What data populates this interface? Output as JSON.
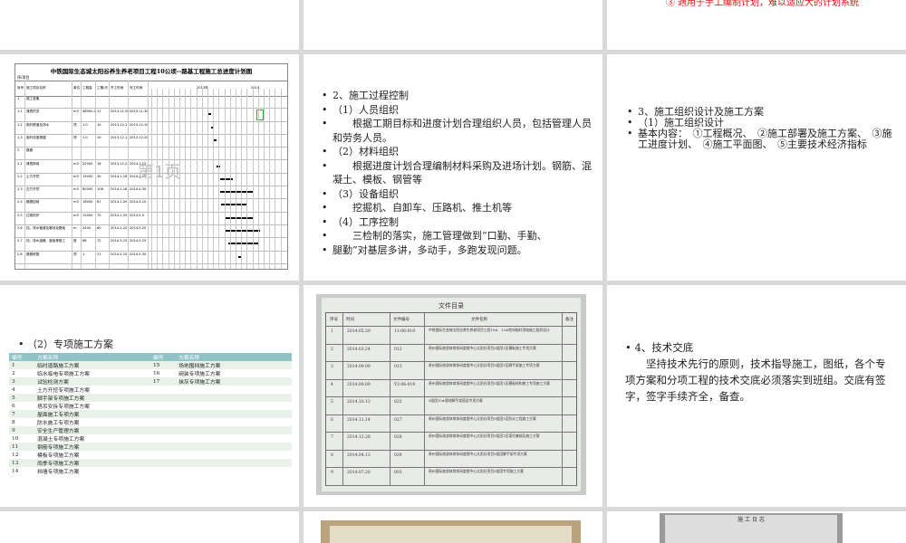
{
  "slide_top_right": {
    "text": "③ 適用于手工编制计划，难以适应大的计划系统"
  },
  "gantt": {
    "title": "中铁国际生态城太阳谷养生养老项目工程10公顷--路基工程施工总进度计划图",
    "subtitle": "序/项目",
    "headers": [
      "序号",
      "施工项目名称",
      "单位",
      "工程量",
      "工期/天",
      "开工时间",
      "完工时间",
      "2013年",
      "2014"
    ],
    "rows": [
      {
        "no": "1",
        "name": "施工准备",
        "unit": "",
        "qty": "",
        "days": "",
        "start": "",
        "end": ""
      },
      {
        "no": "1.1",
        "name": "清表挖淤",
        "unit": "m3",
        "qty": "46000.0",
        "days": "11",
        "start": "2013.11.20",
        "end": "2013.11.30"
      },
      {
        "no": "1.2",
        "name": "临时便道及排水",
        "unit": "项",
        "qty": "1.0",
        "days": "10",
        "start": "2013.12.1",
        "end": "2013.12.10"
      },
      {
        "no": "1.3",
        "name": "临时设施搭建",
        "unit": "项",
        "qty": "1.0",
        "days": "10",
        "start": "2013.12.11",
        "end": "2013.12.20"
      },
      {
        "no": "2",
        "name": "路基",
        "unit": "",
        "qty": "",
        "days": "",
        "start": "",
        "end": ""
      },
      {
        "no": "2.1",
        "name": "清表换填",
        "unit": "m3",
        "qty": "22000",
        "days": "16",
        "start": "2013.12.21",
        "end": "2014.1.15"
      },
      {
        "no": "2.2",
        "name": "土方开挖",
        "unit": "m3",
        "qty": "15000",
        "days": "30",
        "start": "2014.1.16",
        "end": "2014.2.15"
      },
      {
        "no": "2.3",
        "name": "石方开挖",
        "unit": "m3",
        "qty": "80000",
        "days": "108",
        "start": "2014.1.18",
        "end": "2014.4.30"
      },
      {
        "no": "2.4",
        "name": "路基回填",
        "unit": "m3",
        "qty": "18000",
        "days": "81",
        "start": "2014.1.20",
        "end": "2014.4.10"
      },
      {
        "no": "2.5",
        "name": "边坡防护",
        "unit": "m3",
        "qty": "15000",
        "days": "70",
        "start": "2014.2.20",
        "end": "2014.5.0"
      },
      {
        "no": "2.6",
        "name": "挡、排水管道及管线及基础",
        "unit": "m",
        "qty": "2440",
        "days": "60",
        "start": "2014.2.20",
        "end": "2014.5.20"
      },
      {
        "no": "2.7",
        "name": "挡、排水涵管、盖板等施工",
        "unit": "座",
        "qty": "68",
        "days": "72",
        "start": "2014.3.15",
        "end": "2014.5.25"
      },
      {
        "no": "2.8",
        "name": "路基修整",
        "unit": "项",
        "qty": "1",
        "days": "21",
        "start": "2014.5.10",
        "end": "2014.5.30"
      }
    ],
    "watermark": "第1页"
  },
  "process_control": {
    "items": [
      "2、施工过程控制",
      "（1）人员组织",
      "　　根据工期目标和进度计划合理组织人员，包括管理人员和劳务人员。",
      "（2）材料组织",
      "　　根据进度计划合理编制材料采购及进场计划。钢筋、混凝土、模板、钢管等",
      "（3）设备组织",
      "　　挖掘机、自卸车、压路机、推土机等",
      "（4）工序控制",
      "　　三检制的落实，施工管理做到“口勤、手勤、",
      "腿勤”对基层多讲，多动手，多跑发现问题。"
    ]
  },
  "org_design": {
    "items": [
      "3、施工组织设计及施工方案",
      "（1）施工组织设计",
      "基本内容：　①工程概况、　②施工部署及施工方案、　③施工进度计划、　④施工平面图、　⑤主要技术经济指标"
    ]
  },
  "special_plans": {
    "label": "（2）专项施工方案",
    "headers": [
      "编号",
      "方案名称",
      "编号",
      "方案名称"
    ],
    "rows": [
      [
        "1",
        "临时道路施工方案",
        "15",
        "场地围挡施工方案"
      ],
      [
        "2",
        "临水临电专项施工方案",
        "16",
        "碗装专项施工方案"
      ],
      [
        "3",
        "试验检测方案",
        "17",
        "抹灰专项施工方案"
      ],
      [
        "4",
        "土方开挖专项施工方案",
        "",
        ""
      ],
      [
        "5",
        "脚手架专项施工方案",
        "",
        ""
      ],
      [
        "6",
        "塔吊安拆专项施工方案",
        "",
        ""
      ],
      [
        "7",
        "屋面施工专项方案",
        "",
        ""
      ],
      [
        "8",
        "防水施工专项方案",
        "",
        ""
      ],
      [
        "9",
        "安全生产管理方案",
        "",
        ""
      ],
      [
        "10",
        "混凝土专项施工方案",
        "",
        ""
      ],
      [
        "11",
        "钢筋专项施工方案",
        "",
        ""
      ],
      [
        "12",
        "模板专项施工方案",
        "",
        ""
      ],
      [
        "13",
        "雨季专项施工方案",
        "",
        ""
      ],
      [
        "14",
        "挡墙专项施工方案",
        "",
        ""
      ]
    ]
  },
  "file_directory": {
    "title": "文件目录",
    "headers": [
      "序号",
      "时间",
      "文件编号",
      "文件名称",
      "备注"
    ],
    "rows": [
      [
        "1",
        "2014.05.29",
        "11-06-019",
        "中铁国际生态城太阳谷养生养老项目工程10#、12#地块临时用电施工组织设计"
      ],
      [
        "2",
        "2014.03.24",
        "012",
        "贵州国际旅游体育休闲度假中心太阳谷项目5组团1区模板施工专项方案"
      ],
      [
        "3",
        "2014.09.09",
        "013",
        "贵州国际旅游体育休闲度假中心太阳谷项目5组团1区脚手架施工专项方案"
      ],
      [
        "4",
        "2014.09.09",
        "Y2-06-019",
        "贵州国际旅游体育休闲度假中心太阳谷项目5组团1区模板结构施工专项施工方案"
      ],
      [
        "5",
        "2014.10.13",
        "025",
        "5组团10#落地脚手架搭设专项方案"
      ],
      [
        "6",
        "2014.11.14",
        "027",
        "贵州国际旅游体育休闲度假中心太阳谷项目5组团1区防水工程施工方案"
      ],
      [
        "7",
        "2014.12.26",
        "028",
        "贵州国际旅游体育休闲度假中心太阳谷项目5组团1区塔吊基础及施工方案"
      ],
      [
        "8",
        "2014.04.13",
        "029",
        "贵州国际旅游体育休闲度假中心太阳谷项目5组团脚手架专项方案"
      ],
      [
        "9",
        "2014.07.20",
        "003",
        "贵州国际旅游体育休闲度假中心太阳谷项目5组团专项施工方案"
      ]
    ]
  },
  "disclosure": {
    "heading": "4、技术交底",
    "body": "　　坚持技术先行的原则，技术指导施工，图纸，各个专项方案和分项工程的技术交底必须落实到班组。交底有签字，签字手续齐全，备查。"
  },
  "construction_log": {
    "title": "施 工 日 志"
  },
  "colors": {
    "table_header": "#8fc3c7",
    "row_alt": "#e8f2e8",
    "accent_red": "#dd1111"
  }
}
